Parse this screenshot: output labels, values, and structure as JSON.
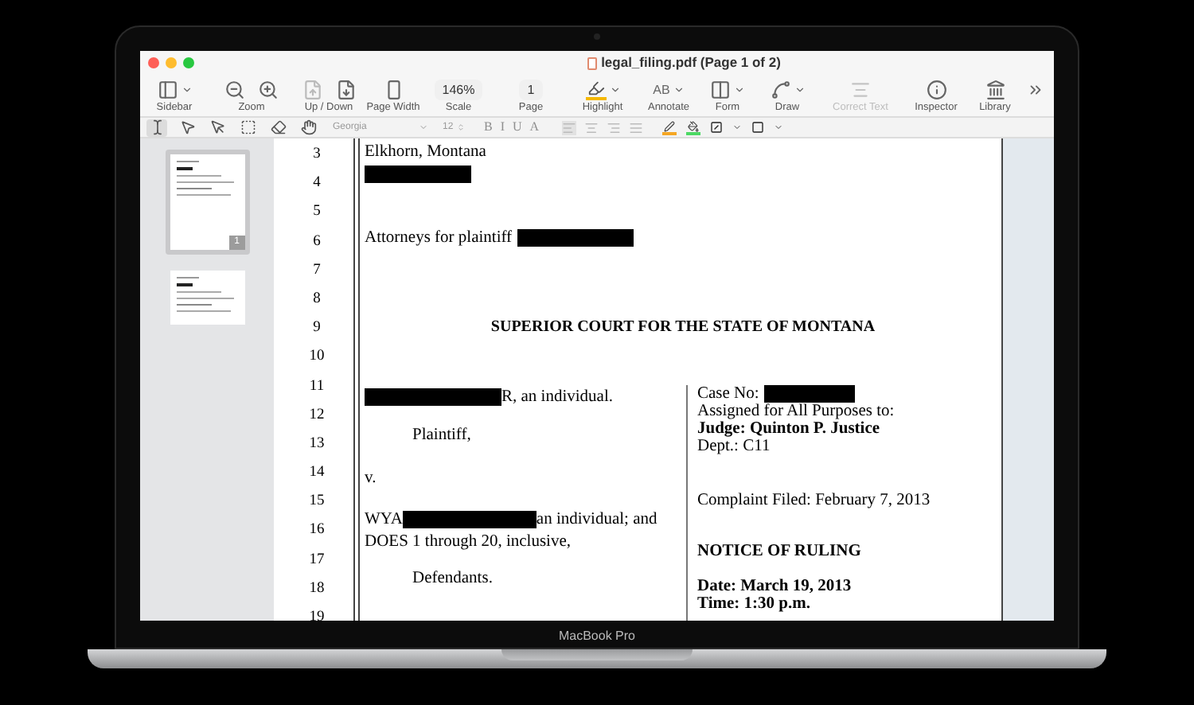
{
  "window": {
    "title": "legal_filing.pdf (Page 1 of 2)"
  },
  "toolbar": [
    {
      "kind": "sidebar",
      "label": "Sidebar",
      "dropdown": true,
      "disabled": false
    },
    {
      "kind": "zoom",
      "label": "Zoom",
      "dropdown": false,
      "disabled": false
    },
    {
      "kind": "updown",
      "label": "Up / Down",
      "dropdown": false,
      "disabled": false
    },
    {
      "kind": "pagewidth",
      "label": "Page Width",
      "dropdown": false,
      "disabled": false
    },
    {
      "kind": "field",
      "label": "Scale",
      "value": "146%",
      "dropdown": false,
      "disabled": false
    },
    {
      "kind": "field",
      "label": "Page",
      "value": "1",
      "dropdown": false,
      "disabled": false
    },
    {
      "kind": "highlight",
      "label": "Highlight",
      "dropdown": true,
      "disabled": false
    },
    {
      "kind": "glyph",
      "label": "Annotate",
      "glyph": "AB",
      "dropdown": true,
      "disabled": false
    },
    {
      "kind": "form",
      "label": "Form",
      "dropdown": true,
      "disabled": false
    },
    {
      "kind": "draw",
      "label": "Draw",
      "dropdown": true,
      "disabled": false
    },
    {
      "kind": "correct",
      "label": "Correct Text",
      "dropdown": false,
      "disabled": true
    },
    {
      "kind": "inspector",
      "label": "Inspector",
      "dropdown": false,
      "disabled": false
    },
    {
      "kind": "library",
      "label": "Library",
      "dropdown": false,
      "disabled": false
    }
  ],
  "format_bar": {
    "tools": [
      {
        "kind": "text",
        "selected": true
      },
      {
        "kind": "arrow",
        "selected": false
      },
      {
        "kind": "arrow-outline",
        "selected": false
      },
      {
        "kind": "marquee",
        "selected": false
      },
      {
        "kind": "eraser",
        "selected": false
      },
      {
        "kind": "hand",
        "selected": false
      }
    ],
    "font": "Georgia",
    "size": "12",
    "styles": [
      "B",
      "I",
      "U",
      "A"
    ],
    "disabled": true
  },
  "sidebar": {
    "thumbnails": [
      {
        "selected": true,
        "badge": "1"
      },
      {
        "selected": false
      }
    ]
  },
  "document": {
    "line_numbers": [
      "3",
      "4",
      "5",
      "6",
      "7",
      "8",
      "9",
      "10",
      "11",
      "12",
      "13",
      "14",
      "15",
      "16",
      "17",
      "18",
      "19"
    ],
    "address": "Elkhorn, Montana",
    "attorneys": "Attorneys for plaintiff",
    "court_title": "SUPERIOR COURT FOR THE STATE OF MONTANA",
    "plaintiff": "R, an individual.",
    "plaintiff_role": "Plaintiff,",
    "versus": "v.",
    "defendant_prefix": "WYA",
    "defendant_suffix": "an individual; and",
    "defendant_line2": "DOES 1 through 20, inclusive,",
    "defendant_role": "Defendants.",
    "case_no": "Case No:",
    "assigned": "Assigned for All Purposes to:",
    "judge": "Judge: Quinton P. Justice",
    "dept": "Dept.: C11",
    "complaint": "Complaint Filed: February 7, 2013",
    "notice": "NOTICE OF RULING",
    "date": "Date: March 19, 2013",
    "time": "Time: 1:30 p.m."
  },
  "device_label": "MacBook Pro"
}
